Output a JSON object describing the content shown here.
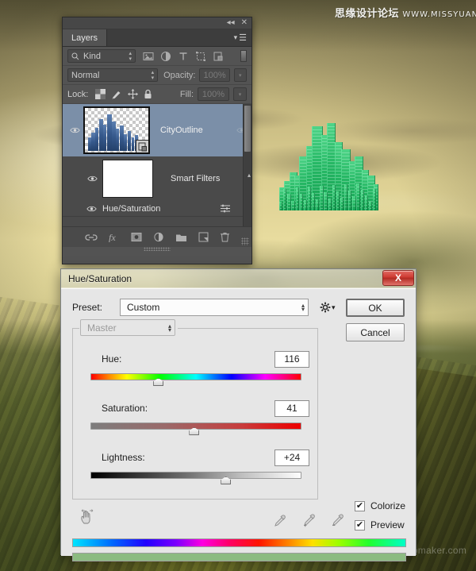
{
  "watermarks": {
    "top_cn": "思缘设计论坛",
    "top_url": "WWW.MISSYUAN.COM",
    "bottom": "photoshopmaker.com"
  },
  "layers_panel": {
    "tab_label": "Layers",
    "titlebar": {
      "collapse_icon": "collapse-icon",
      "close_icon": "close-icon"
    },
    "filter": {
      "kind_label": "Kind",
      "search_icon": "search-icon",
      "icons": [
        "pixel-filter-icon",
        "adjustment-filter-icon",
        "type-filter-icon",
        "shape-filter-icon",
        "smartobject-filter-icon"
      ]
    },
    "blend": {
      "mode": "Normal",
      "opacity_label": "Opacity:",
      "opacity_value": "100%"
    },
    "lock": {
      "label": "Lock:",
      "icons": [
        "lock-transparency-icon",
        "lock-image-icon",
        "lock-position-icon",
        "lock-all-icon"
      ],
      "fill_label": "Fill:",
      "fill_value": "100%"
    },
    "layers": [
      {
        "name": "CityOutline",
        "visible_icon": "eye-icon",
        "thumb": "city-outline-thumbnail",
        "badge_icon": "smart-object-badge-icon",
        "selected": true
      }
    ],
    "smart_filters": {
      "name": "Smart Filters",
      "mask_thumb": "white-mask-thumbnail",
      "filters": [
        {
          "name": "Hue/Saturation",
          "visible_icon": "eye-icon",
          "options_icon": "blending-options-icon"
        }
      ]
    },
    "footer_icons": [
      "link-layers-icon",
      "layer-style-fx-icon",
      "add-mask-icon",
      "new-adjustment-layer-icon",
      "new-group-icon",
      "new-layer-icon",
      "delete-layer-icon"
    ]
  },
  "dialog": {
    "title": "Hue/Saturation",
    "close_label": "X",
    "preset_label": "Preset:",
    "preset_value": "Custom",
    "preset_gear_icon": "gear-icon",
    "ok_label": "OK",
    "cancel_label": "Cancel",
    "channel_value": "Master",
    "sliders": [
      {
        "name": "Hue:",
        "value": "116",
        "pos_pct": 32
      },
      {
        "name": "Saturation:",
        "value": "41",
        "pos_pct": 49
      },
      {
        "name": "Lightness:",
        "value": "+24",
        "pos_pct": 64
      }
    ],
    "hand_tool_icon": "on-image-adjust-hand-icon",
    "droppers": [
      "eyedropper-icon",
      "eyedropper-add-icon",
      "eyedropper-subtract-icon"
    ],
    "checkboxes": [
      {
        "name": "Colorize",
        "checked": true,
        "mark": "✔"
      },
      {
        "name": "Preview",
        "checked": true,
        "mark": "✔"
      }
    ],
    "spectrum_top_name": "source-hue-spectrum",
    "spectrum_bottom_name": "result-color-bar",
    "result_color": "#8cbb81"
  },
  "canvas": {
    "description": "emerald-city-composite"
  }
}
